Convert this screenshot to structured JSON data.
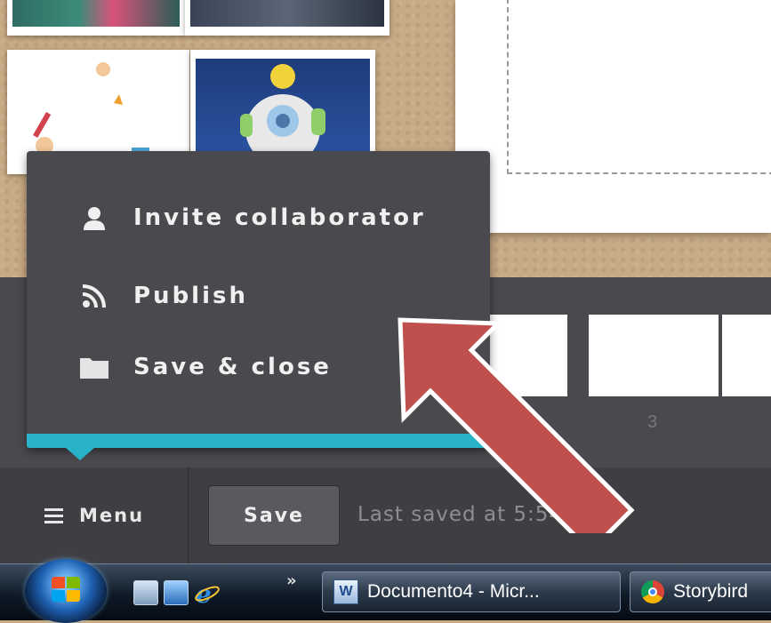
{
  "dropdown_menu": {
    "items": [
      {
        "label": "Invite collaborator",
        "icon": "person-icon"
      },
      {
        "label": "Publish",
        "icon": "rss-feed-icon"
      },
      {
        "label": "Save & close",
        "icon": "folder-icon"
      }
    ],
    "accent_color": "#29b3c9"
  },
  "page_strip": {
    "page_label": "3"
  },
  "bottom_bar": {
    "menu_label": "Menu",
    "save_label": "Save",
    "status_text": "Last saved at 5:54 pm"
  },
  "taskbar": {
    "overflow_glyph": "»",
    "tasks": [
      {
        "label": "Documento4 - Micr...",
        "icon": "word-document-icon"
      },
      {
        "label": "Storybird",
        "icon": "chrome-icon"
      }
    ]
  },
  "annotation": {
    "arrow_color": "#c0504d"
  }
}
